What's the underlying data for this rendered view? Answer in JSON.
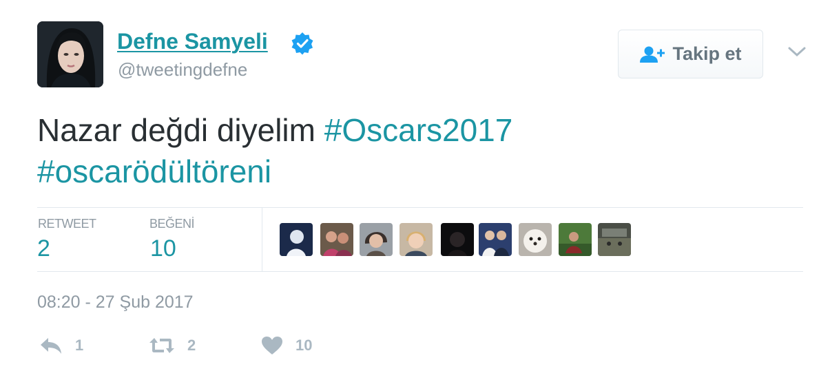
{
  "user": {
    "name": "Defne Samyeli",
    "handle": "@tweetingdefne",
    "verified": true
  },
  "follow_button": {
    "label": "Takip et",
    "icon": "add-user-icon"
  },
  "tweet": {
    "text": "Nazar değdi diyelim ",
    "hashtags": [
      "#Oscars2017",
      "#oscarödültöreni"
    ]
  },
  "stats": {
    "retweets_label": "RETWEET",
    "retweets": "2",
    "likes_label": "BEĞENİ",
    "likes": "10",
    "liker_count": 9
  },
  "timestamp": "08:20 - 27 Şub 2017",
  "actions": {
    "reply": {
      "icon": "reply-icon",
      "count": "1"
    },
    "retweet": {
      "icon": "retweet-icon",
      "count": "2"
    },
    "like": {
      "icon": "heart-icon",
      "count": "10"
    }
  },
  "colors": {
    "link": "#1b95a3",
    "text": "#292f33",
    "muted": "#8f9aa3",
    "verified": "#1da1f2",
    "icon": "#aab8c2"
  }
}
